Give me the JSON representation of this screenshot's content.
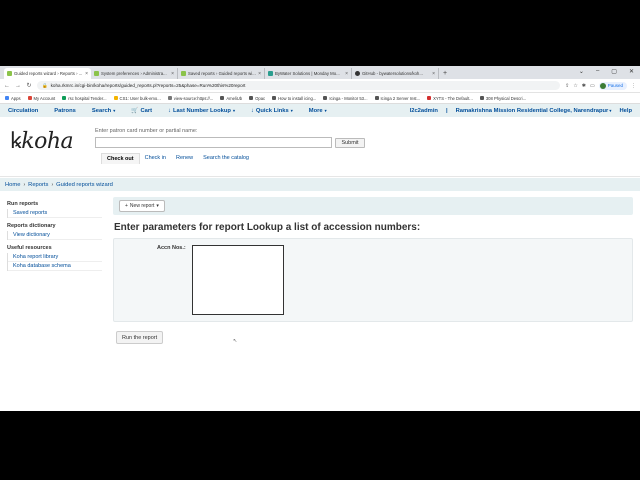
{
  "browser": {
    "tabs": [
      {
        "title": "Guided reports wizard › Reports › ...",
        "color": "#8bc34a",
        "active": true
      },
      {
        "title": "System preferences › Administra...",
        "color": "#8bc34a",
        "active": false
      },
      {
        "title": "Saved reports › Guided reports wi...",
        "color": "#8bc34a",
        "active": false
      },
      {
        "title": "ByWater Solutions | Monday Mo...",
        "color": "#2a9d8f",
        "active": false
      },
      {
        "title": "GitHub - bywatersolutions/koh...",
        "color": "#333333",
        "active": false
      }
    ],
    "new_tab": "+",
    "url": "koha.rkmrc.in/cgi-bin/koha/reports/guided_reports.pl?reports=25&phase=Run%20this%20report",
    "profile_status": "Paused",
    "bookmarks": [
      {
        "label": "Apps",
        "color": "#4285f4"
      },
      {
        "label": "My Account",
        "color": "#db4437"
      },
      {
        "label": "rsc hospital Tender...",
        "color": "#0f9d58"
      },
      {
        "label": "CS1: User bulk-emo...",
        "color": "#f4b400"
      },
      {
        "label": "view-source:https://...",
        "color": "#777777"
      },
      {
        "label": "AmeliUb",
        "color": "#555555"
      },
      {
        "label": "Opac",
        "color": "#555555"
      },
      {
        "label": "How to install icing...",
        "color": "#555555"
      },
      {
        "label": "Icinga - Monitor 53...",
        "color": "#555555"
      },
      {
        "label": "Icinga 2 Server Inst...",
        "color": "#555555"
      },
      {
        "label": "XYTS - The Default...",
        "color": "#d32f2f"
      },
      {
        "label": "308 Physical Descri...",
        "color": "#555555"
      }
    ]
  },
  "koha_nav": {
    "items": [
      "Circulation",
      "Patrons",
      "Search",
      "Cart",
      "Last Number Lookup",
      "Quick Links",
      "More"
    ],
    "user": "l2c2admin",
    "library": "Ramakrishna Mission Residential College, Narendrapur",
    "help": "Help"
  },
  "search": {
    "logo": "koha",
    "label": "Enter patron card number or partial name:",
    "submit": "Submit",
    "tabs": [
      "Check out",
      "Check in",
      "Renew",
      "Search the catalog"
    ]
  },
  "breadcrumb": [
    "Home",
    "Reports",
    "Guided reports wizard"
  ],
  "sidebar": {
    "sections": [
      {
        "heading": "Run reports",
        "links": [
          "Saved reports"
        ]
      },
      {
        "heading": "Reports dictionary",
        "links": [
          "View dictionary"
        ]
      },
      {
        "heading": "Useful resources",
        "links": [
          "Koha report library",
          "Koha database schema"
        ]
      }
    ]
  },
  "toolbar": {
    "new_report": "New report"
  },
  "page_title": "Enter parameters for report Lookup a list of accession numbers:",
  "form": {
    "field_label": "Accn Nos.:",
    "field_value": ""
  },
  "run_button": "Run the report"
}
